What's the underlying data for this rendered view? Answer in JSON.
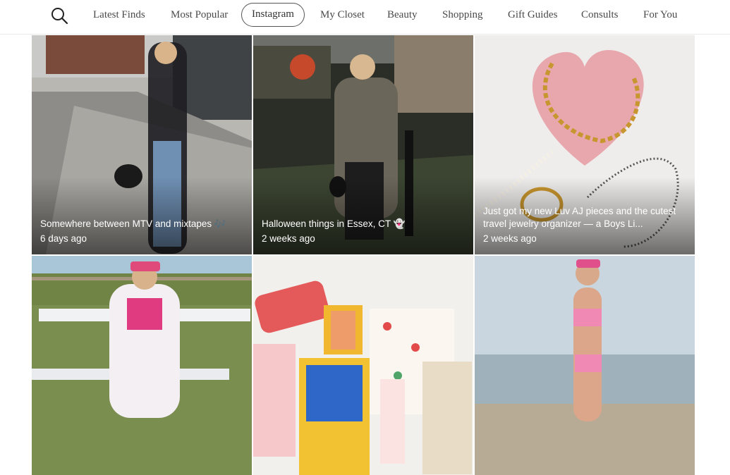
{
  "nav": {
    "search_icon": "search-icon",
    "items": [
      {
        "label": "Latest Finds",
        "active": false
      },
      {
        "label": "Most Popular",
        "active": false
      },
      {
        "label": "Instagram",
        "active": true
      },
      {
        "label": "My Closet",
        "active": false
      },
      {
        "label": "Beauty",
        "active": false
      },
      {
        "label": "Shopping",
        "active": false
      },
      {
        "label": "Gift Guides",
        "active": false
      },
      {
        "label": "Consults",
        "active": false
      },
      {
        "label": "For You",
        "active": false
      }
    ]
  },
  "posts": [
    {
      "caption": "Somewhere between MTV and mixtapes 🎶",
      "age": "6 days ago"
    },
    {
      "caption": "Halloween things in Essex, CT 👻",
      "age": "2 weeks ago"
    },
    {
      "caption": "Just got my new Luv AJ pieces and the cutest travel jewelry organizer — a Boys Li...",
      "age": "2 weeks ago"
    },
    {
      "caption": "",
      "age": ""
    },
    {
      "caption": "",
      "age": ""
    },
    {
      "caption": "",
      "age": ""
    }
  ]
}
